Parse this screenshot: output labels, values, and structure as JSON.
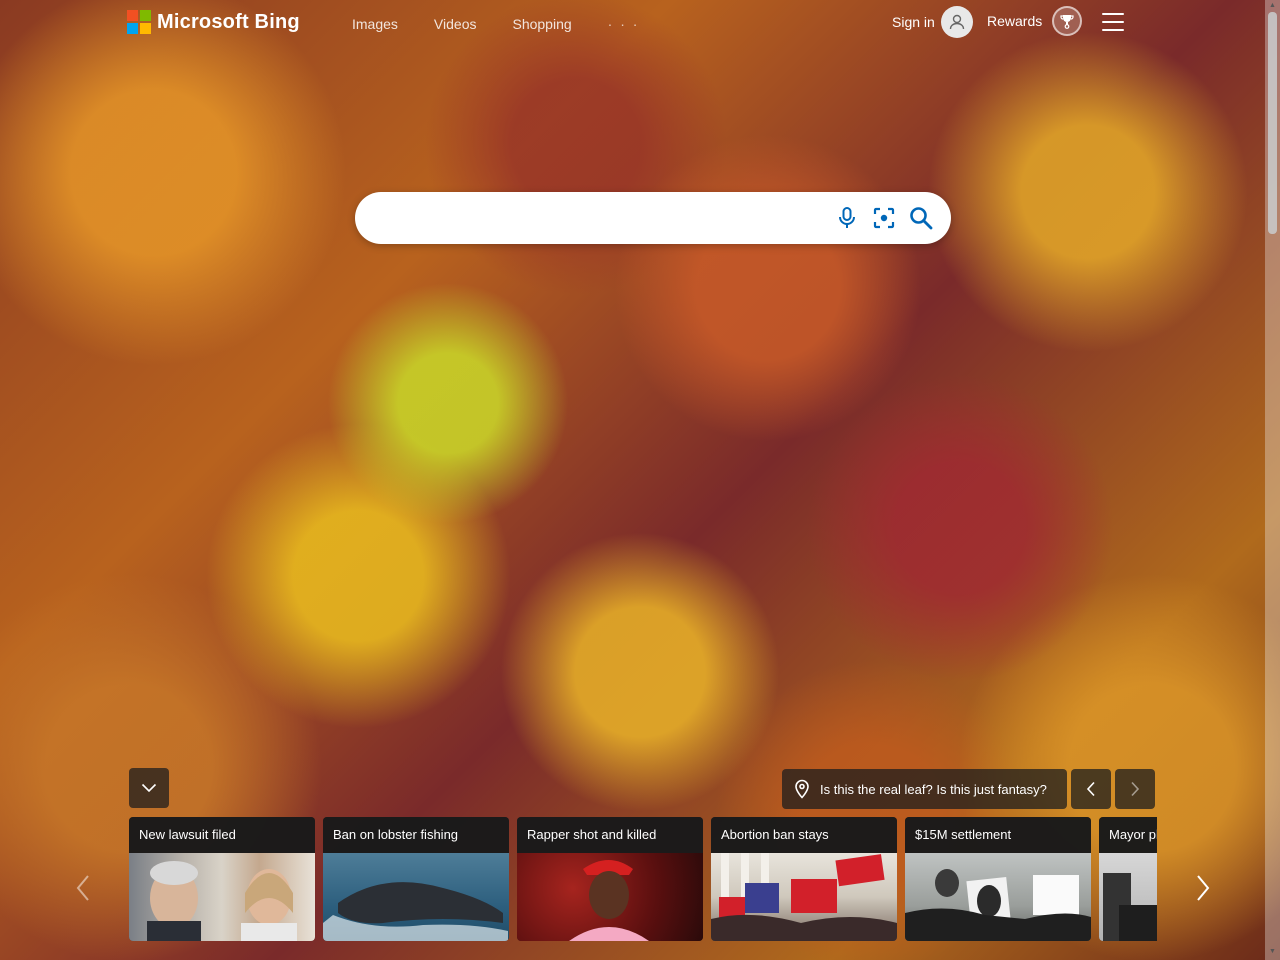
{
  "header": {
    "logo_text": "Microsoft Bing",
    "nav": [
      {
        "label": "Images"
      },
      {
        "label": "Videos"
      },
      {
        "label": "Shopping"
      }
    ],
    "more_label": "· · ·",
    "signin_label": "Sign in",
    "rewards_label": "Rewards"
  },
  "search": {
    "value": "",
    "icons": [
      "microphone-icon",
      "visual-search-icon",
      "search-icon"
    ]
  },
  "image_caption": "Is this the real leaf? Is this just fantasy?",
  "news": [
    {
      "title": "New lawsuit filed"
    },
    {
      "title": "Ban on lobster fishing"
    },
    {
      "title": "Rapper shot and killed"
    },
    {
      "title": "Abortion ban stays"
    },
    {
      "title": "$15M settlement"
    },
    {
      "title": "Mayor pl"
    }
  ],
  "colors": {
    "accent": "#0067b8",
    "ms_red": "#f25022",
    "ms_green": "#7fba00",
    "ms_blue": "#00a4ef",
    "ms_yellow": "#ffb900"
  }
}
